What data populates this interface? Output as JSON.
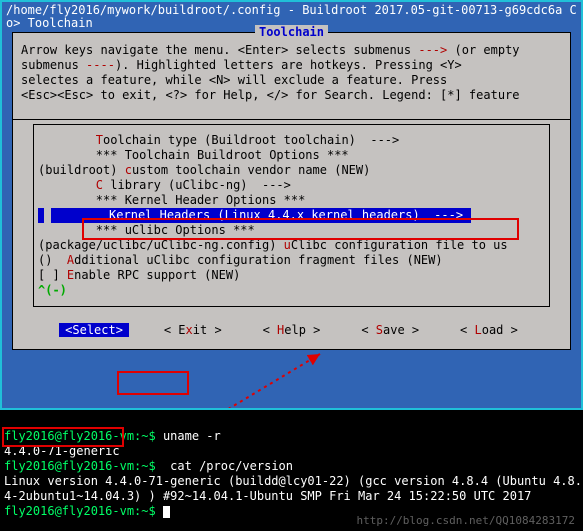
{
  "titlebar": {
    "path": "/home/fly2016/mywork/buildroot/.config - Buildroot 2017.05-git-00713-g69cdc6a C",
    "sub": "o> Toolchain"
  },
  "dialog": {
    "title": "Toolchain",
    "instructions_l1a": "Arrow keys navigate the menu.  <Enter> selects submenus ",
    "instructions_l1b": " (or empty",
    "instructions_l2a": "submenus ",
    "instructions_l2b": ").  Highlighted letters are hotkeys.  Pressing <Y>",
    "instructions_l3": "selectes a feature, while <N> will exclude a feature.  Press",
    "instructions_l4": "<Esc><Esc> to exit, <?> for Help, </> for Search.  Legend: [*] feature",
    "arrow3": "--->",
    "dash4": "----"
  },
  "menu": {
    "r0_pre": "        ",
    "r0_hot": "T",
    "r0_txt": "oolchain type (Buildroot toolchain)  --->",
    "r1": "        *** Toolchain Buildroot Options ***",
    "r2_pre": "(buildroot) ",
    "r2_hot": "c",
    "r2_txt": "ustom toolchain vendor name (NEW)",
    "r3_pre": "        ",
    "r3_hot": "C",
    "r3_txt": " library (uClibc-ng)  --->",
    "r4": "        *** Kernel Header Options ***",
    "r5_pre": "        ",
    "r5_hot": "K",
    "r5_txt": "ernel Headers (Linux 4.4.x kernel headers)  --->",
    "r6": "        *** uClibc Options ***",
    "r7_pre": "(package/uclibc/uClibc-ng.config) ",
    "r7_hot": "u",
    "r7_txt": "Clibc configuration file to us",
    "r8_pre": "()  ",
    "r8_hot": "A",
    "r8_txt": "dditional uClibc configuration fragment files (NEW)",
    "r9_pre": "[ ] ",
    "r9_hot": "E",
    "r9_txt": "nable RPC support (NEW)",
    "percent": "^(-)"
  },
  "buttons": {
    "select": "<Select>",
    "exit_l": "< E",
    "exit_h": "x",
    "exit_r": "it >",
    "help_l": "< ",
    "help_h": "H",
    "help_r": "elp >",
    "save_l": "< ",
    "save_h": "S",
    "save_r": "ave >",
    "load_l": "< ",
    "load_h": "L",
    "load_r": "oad >"
  },
  "terminal": {
    "p1": "fly2016@fly2016-vm:~$ ",
    "c1": "uname -r",
    "o1": "4.4.0-71-generic",
    "p2": "fly2016@fly2016-vm:~$ ",
    "c2": " cat /proc/version",
    "o2a": "Linux version 4.4.0-71-generic (buildd@lcy01-22) (gcc version 4.8.4 (Ubuntu 4.8.",
    "o2b": "4-2ubuntu1~14.04.3) ) #92~14.04.1-Ubuntu SMP Fri Mar 24 15:22:50 UTC 2017",
    "p3": "fly2016@fly2016-vm:~$ "
  },
  "watermark": "http://blog.csdn.net/QQ1084283172"
}
